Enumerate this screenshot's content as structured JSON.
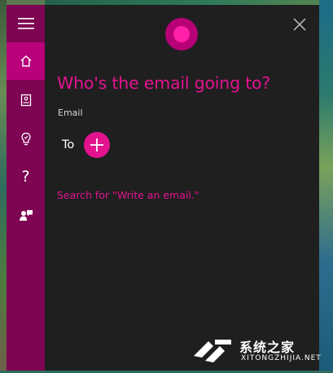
{
  "sidebar": {
    "items": [
      {
        "icon": "hamburger-menu-icon"
      },
      {
        "icon": "home-icon",
        "active": true
      },
      {
        "icon": "notebook-icon"
      },
      {
        "icon": "reminders-icon"
      },
      {
        "icon": "help-icon",
        "label": "?"
      },
      {
        "icon": "feedback-icon"
      }
    ]
  },
  "main": {
    "question": "Who's the email going to?",
    "field_label": "Email",
    "to_label": "To",
    "search_link": "Search for \"Write an email.\""
  },
  "colors": {
    "accent": "#e3138e",
    "sidebar": "#7d0552",
    "sidebar_active": "#b7007a",
    "panel": "#1f1f20"
  },
  "watermark": {
    "title": "系统之家",
    "url": "XITONGZHIJIA.NET"
  }
}
